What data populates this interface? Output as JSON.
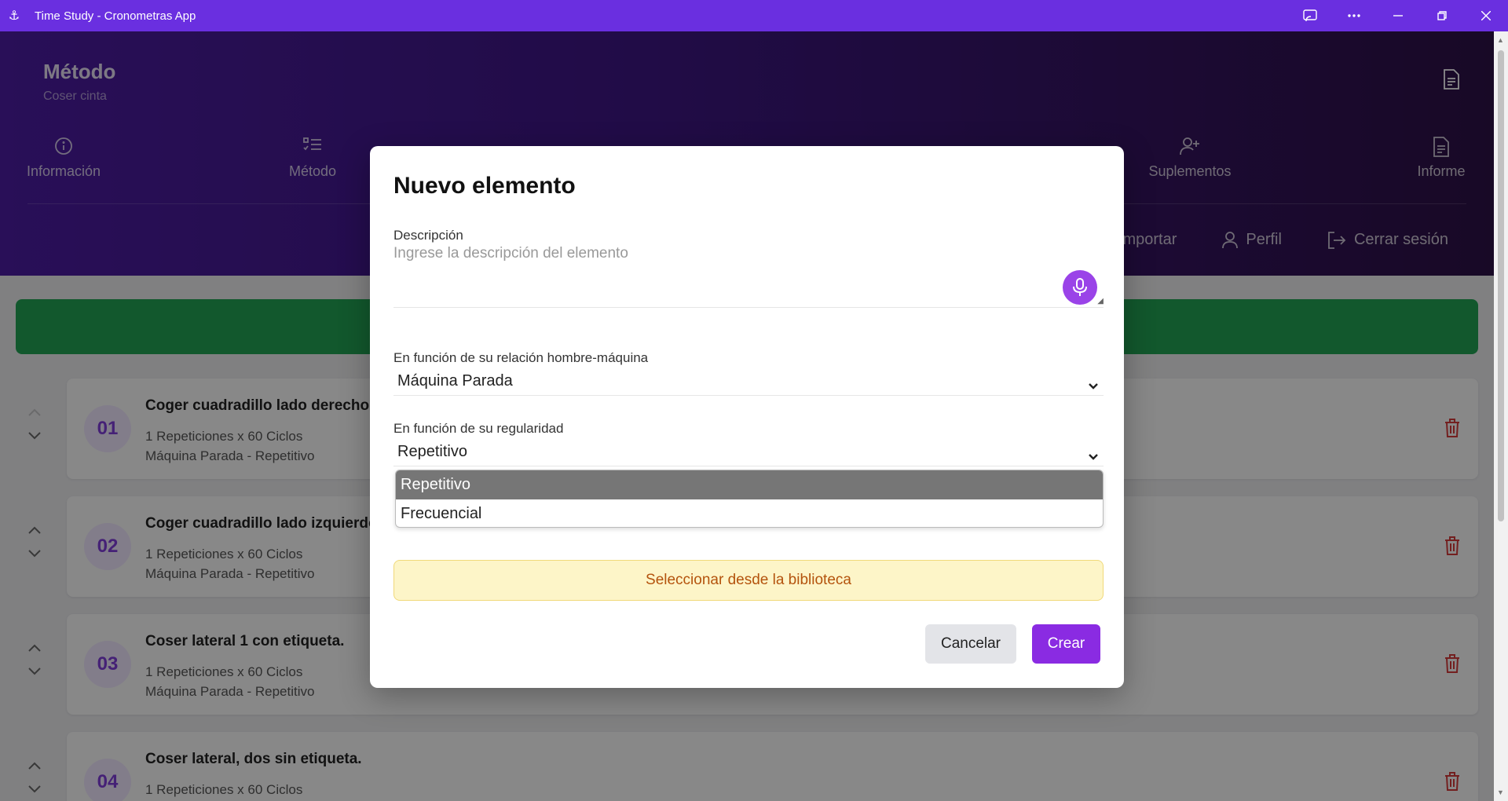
{
  "window": {
    "title": "Time Study - Cronometras App"
  },
  "header": {
    "title": "Método",
    "subtitle": "Coser cinta",
    "nav": [
      {
        "label": "Información",
        "icon": "info-icon"
      },
      {
        "label": "Método",
        "icon": "list-check-icon"
      },
      {
        "label": "Suplementos",
        "icon": "user-plus-icon"
      },
      {
        "label": "Informe",
        "icon": "document-icon"
      }
    ],
    "actions": [
      {
        "label": "Importar"
      },
      {
        "label": "Perfil",
        "icon": "user-icon"
      },
      {
        "label": "Cerrar sesión",
        "icon": "logout-icon"
      }
    ]
  },
  "elements": [
    {
      "num": "01",
      "title": "Coger cuadradillo lado derecho",
      "line1": "1 Repeticiones x 60 Ciclos",
      "line2": "Máquina Parada - Repetitivo"
    },
    {
      "num": "02",
      "title": "Coger cuadradillo lado izquierdo",
      "line1": "1 Repeticiones x 60 Ciclos",
      "line2": "Máquina Parada - Repetitivo"
    },
    {
      "num": "03",
      "title": "Coser lateral 1 con etiqueta.",
      "line1": "1 Repeticiones x 60 Ciclos",
      "line2": "Máquina Parada - Repetitivo"
    },
    {
      "num": "04",
      "title": "Coser lateral, dos sin etiqueta.",
      "line1": "1 Repeticiones x 60 Ciclos",
      "line2": ""
    }
  ],
  "modal": {
    "title": "Nuevo elemento",
    "description_label": "Descripción",
    "description_placeholder": "Ingrese la descripción del elemento",
    "relation_label": "En función de su relación hombre-máquina",
    "relation_value": "Máquina Parada",
    "regularity_label": "En función de su regularidad",
    "regularity_value": "Repetitivo",
    "regularity_options": [
      "Repetitivo",
      "Frecuencial"
    ],
    "library_button": "Seleccionar desde la biblioteca",
    "cancel": "Cancelar",
    "create": "Crear"
  },
  "colors": {
    "titlebar": "#6a2fe0",
    "accent": "#8a2be2",
    "success": "#22a153",
    "danger": "#d23a3a"
  }
}
